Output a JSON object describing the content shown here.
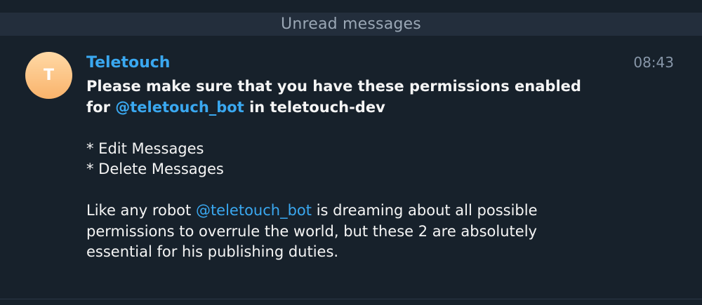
{
  "divider": {
    "label": "Unread messages"
  },
  "message": {
    "avatar_letter": "T",
    "sender": "Teletouch",
    "time": "08:43",
    "bold_line1": "Please make sure that you have these permissions enabled",
    "bold_line2_prefix": "for ",
    "mention": "@teletouch_bot",
    "bold_line2_suffix": " in teletouch-dev",
    "perm1": "* Edit Messages",
    "perm2": "* Delete Messages",
    "para_prefix": "Like any robot ",
    "para_line1_suffix": " is dreaming about all possible",
    "para_line2": "permissions to overrule the world, but these 2 are absolutely",
    "para_line3": "essential for his publishing duties."
  },
  "colors": {
    "background": "#17212b",
    "divider_background": "#232e3c",
    "accent": "#3aa8f0",
    "avatar_gradient_top": "#ffd9a6",
    "avatar_gradient_bottom": "#f9b36b"
  }
}
